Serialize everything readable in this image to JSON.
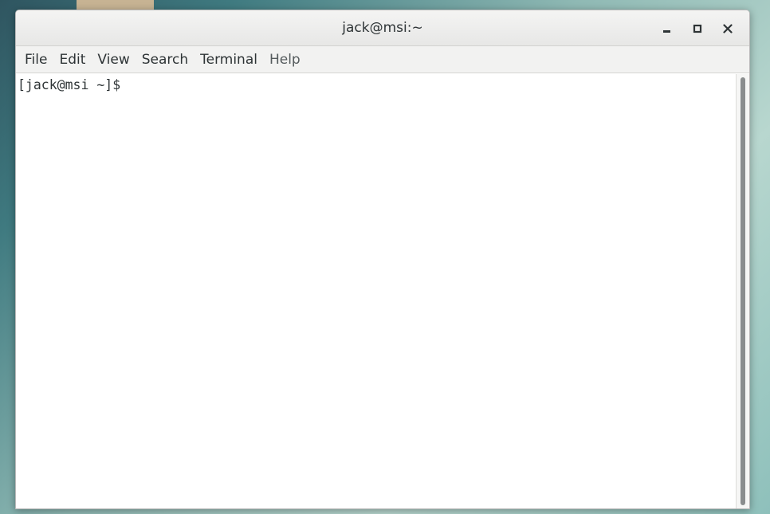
{
  "window": {
    "title": "jack@msi:~"
  },
  "window_controls": {
    "minimize_icon": "minimize-icon",
    "maximize_icon": "maximize-icon",
    "close_icon": "close-icon"
  },
  "menubar": {
    "items": [
      {
        "label": "File"
      },
      {
        "label": "Edit"
      },
      {
        "label": "View"
      },
      {
        "label": "Search"
      },
      {
        "label": "Terminal"
      },
      {
        "label": "Help"
      }
    ]
  },
  "terminal": {
    "prompt": "[jack@msi ~]$"
  },
  "colors": {
    "titlebar": "#e9e9e8",
    "menubar": "#f2f2f1",
    "text": "#2e3436",
    "scroll_thumb": "#8a8d8e"
  }
}
